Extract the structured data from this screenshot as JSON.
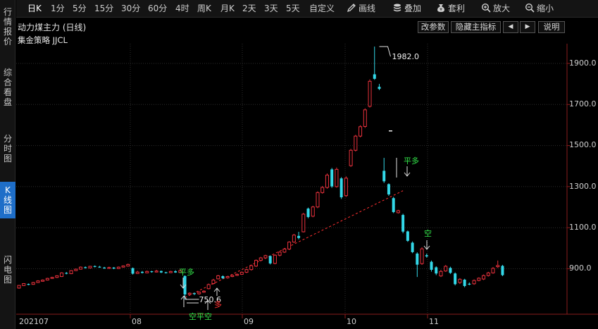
{
  "left_tabs": [
    {
      "label": "行情报价",
      "active": false
    },
    {
      "label": "综合看盘",
      "active": false
    },
    {
      "label": "分时图",
      "active": false
    },
    {
      "label": "K线图",
      "active": true
    },
    {
      "label": "闪电图",
      "active": false
    }
  ],
  "toolbar": {
    "periods": [
      "日K",
      "1分",
      "5分",
      "15分",
      "30分",
      "60分",
      "4时",
      "周K",
      "月K",
      "2天",
      "3天",
      "5天",
      "自定义"
    ],
    "active_period": "日K",
    "tools": [
      {
        "label": "画线",
        "icon": "pencil-icon"
      },
      {
        "label": "叠加",
        "icon": "stack-icon"
      },
      {
        "label": "套利",
        "icon": "arbitrage-icon"
      },
      {
        "label": "放大",
        "icon": "zoom-in-icon"
      },
      {
        "label": "缩小",
        "icon": "zoom-out-icon"
      }
    ]
  },
  "info_bar": {
    "indicator_name": "动力煤主力 (日线)",
    "buttons": {
      "modify_params": "改参数",
      "hide_indicator": "隐藏主指标",
      "prev": "◀",
      "next": "▶",
      "help": "说明"
    }
  },
  "strategy_label": "集金策略 JJCL",
  "chart_data": {
    "type": "candlestick",
    "yaxis": {
      "ticks": [
        "1900.0",
        "1700.0",
        "1500.0",
        "1300.0",
        "1100.0",
        "900.0"
      ]
    },
    "xaxis": {
      "ticks": [
        "202107",
        "08",
        "09",
        "10",
        "11"
      ]
    },
    "high_label": "1982.0",
    "low_label": "750.6",
    "colors": {
      "up": "#e8313c",
      "down": "#33d8e8",
      "signal_green": "#33e54a",
      "signal_red": "#ff3030",
      "trendline": "#ff3030"
    },
    "signals": [
      {
        "text": "平多",
        "color": "green"
      },
      {
        "text": "平多",
        "color": "green"
      },
      {
        "text": "空",
        "color": "green"
      },
      {
        "text": "空平空",
        "color": "green"
      },
      {
        "text": "多",
        "color": "red"
      }
    ],
    "candles": [
      {
        "o": 806,
        "c": 819,
        "h": 821,
        "l": 803
      },
      {
        "o": 818,
        "c": 828,
        "h": 830,
        "l": 816
      },
      {
        "o": 826,
        "c": 823,
        "h": 828,
        "l": 820
      },
      {
        "o": 824,
        "c": 833,
        "h": 836,
        "l": 822
      },
      {
        "o": 833,
        "c": 841,
        "h": 844,
        "l": 831
      },
      {
        "o": 839,
        "c": 845,
        "h": 848,
        "l": 837
      },
      {
        "o": 845,
        "c": 853,
        "h": 856,
        "l": 843
      },
      {
        "o": 853,
        "c": 858,
        "h": 861,
        "l": 851
      },
      {
        "o": 858,
        "c": 866,
        "h": 868,
        "l": 855
      },
      {
        "o": 862,
        "c": 880,
        "h": 883,
        "l": 860
      },
      {
        "o": 880,
        "c": 876,
        "h": 884,
        "l": 873
      },
      {
        "o": 876,
        "c": 891,
        "h": 893,
        "l": 874
      },
      {
        "o": 891,
        "c": 898,
        "h": 901,
        "l": 889
      },
      {
        "o": 898,
        "c": 908,
        "h": 911,
        "l": 896
      },
      {
        "o": 908,
        "c": 904,
        "h": 911,
        "l": 901
      },
      {
        "o": 904,
        "c": 912,
        "h": 914,
        "l": 902
      },
      {
        "o": 913,
        "c": 910,
        "h": 916,
        "l": 907
      },
      {
        "o": 910,
        "c": 907,
        "h": 914,
        "l": 905
      },
      {
        "o": 906,
        "c": 903,
        "h": 909,
        "l": 900
      },
      {
        "o": 902,
        "c": 906,
        "h": 910,
        "l": 900
      },
      {
        "o": 906,
        "c": 901,
        "h": 908,
        "l": 898
      },
      {
        "o": 901,
        "c": 908,
        "h": 911,
        "l": 899
      },
      {
        "o": 908,
        "c": 914,
        "h": 916,
        "l": 906
      },
      {
        "o": 913,
        "c": 921,
        "h": 925,
        "l": 911
      },
      {
        "o": 903,
        "c": 876,
        "h": 906,
        "l": 872
      },
      {
        "o": 877,
        "c": 884,
        "h": 890,
        "l": 875
      },
      {
        "o": 885,
        "c": 880,
        "h": 889,
        "l": 877
      },
      {
        "o": 880,
        "c": 887,
        "h": 891,
        "l": 878
      },
      {
        "o": 888,
        "c": 884,
        "h": 890,
        "l": 881
      },
      {
        "o": 884,
        "c": 889,
        "h": 895,
        "l": 882
      },
      {
        "o": 889,
        "c": 882,
        "h": 891,
        "l": 879
      },
      {
        "o": 883,
        "c": 880,
        "h": 885,
        "l": 877
      },
      {
        "o": 881,
        "c": 887,
        "h": 890,
        "l": 879
      },
      {
        "o": 888,
        "c": 882,
        "h": 893,
        "l": 880
      },
      {
        "o": 882,
        "c": 891,
        "h": 896,
        "l": 880
      },
      {
        "o": 865,
        "c": 775,
        "h": 868,
        "l": 751
      },
      {
        "o": 775,
        "c": 781,
        "h": 785,
        "l": 770
      },
      {
        "o": 781,
        "c": 777,
        "h": 784,
        "l": 772
      },
      {
        "o": 778,
        "c": 786,
        "h": 790,
        "l": 774
      },
      {
        "o": 786,
        "c": 791,
        "h": 795,
        "l": 783
      },
      {
        "o": 803,
        "c": 823,
        "h": 828,
        "l": 800
      },
      {
        "o": 828,
        "c": 845,
        "h": 851,
        "l": 824
      },
      {
        "o": 851,
        "c": 866,
        "h": 870,
        "l": 848
      },
      {
        "o": 864,
        "c": 854,
        "h": 868,
        "l": 850
      },
      {
        "o": 856,
        "c": 862,
        "h": 866,
        "l": 852
      },
      {
        "o": 862,
        "c": 868,
        "h": 872,
        "l": 859
      },
      {
        "o": 868,
        "c": 873,
        "h": 877,
        "l": 865
      },
      {
        "o": 873,
        "c": 883,
        "h": 887,
        "l": 870
      },
      {
        "o": 883,
        "c": 896,
        "h": 900,
        "l": 879
      },
      {
        "o": 896,
        "c": 915,
        "h": 920,
        "l": 891
      },
      {
        "o": 913,
        "c": 941,
        "h": 945,
        "l": 909
      },
      {
        "o": 941,
        "c": 953,
        "h": 958,
        "l": 935
      },
      {
        "o": 953,
        "c": 964,
        "h": 968,
        "l": 948
      },
      {
        "o": 962,
        "c": 926,
        "h": 965,
        "l": 921
      },
      {
        "o": 926,
        "c": 966,
        "h": 970,
        "l": 922
      },
      {
        "o": 966,
        "c": 981,
        "h": 985,
        "l": 960
      },
      {
        "o": 981,
        "c": 996,
        "h": 1001,
        "l": 977
      },
      {
        "o": 996,
        "c": 1030,
        "h": 1034,
        "l": 991
      },
      {
        "o": 1030,
        "c": 1064,
        "h": 1070,
        "l": 1026
      },
      {
        "o": 1060,
        "c": 1050,
        "h": 1080,
        "l": 1043
      },
      {
        "o": 1080,
        "c": 1166,
        "h": 1172,
        "l": 1077
      },
      {
        "o": 1193,
        "c": 1152,
        "h": 1198,
        "l": 1146
      },
      {
        "o": 1156,
        "c": 1201,
        "h": 1207,
        "l": 1151
      },
      {
        "o": 1201,
        "c": 1271,
        "h": 1277,
        "l": 1195
      },
      {
        "o": 1271,
        "c": 1296,
        "h": 1303,
        "l": 1266
      },
      {
        "o": 1296,
        "c": 1356,
        "h": 1364,
        "l": 1290
      },
      {
        "o": 1384,
        "c": 1301,
        "h": 1391,
        "l": 1294
      },
      {
        "o": 1300,
        "c": 1384,
        "h": 1393,
        "l": 1295
      },
      {
        "o": 1340,
        "c": 1248,
        "h": 1346,
        "l": 1240
      },
      {
        "o": 1256,
        "c": 1341,
        "h": 1350,
        "l": 1250
      },
      {
        "o": 1402,
        "c": 1477,
        "h": 1484,
        "l": 1396
      },
      {
        "o": 1477,
        "c": 1546,
        "h": 1552,
        "l": 1471
      },
      {
        "o": 1546,
        "c": 1592,
        "h": 1599,
        "l": 1540
      },
      {
        "o": 1593,
        "c": 1674,
        "h": 1681,
        "l": 1586
      },
      {
        "o": 1691,
        "c": 1813,
        "h": 1822,
        "l": 1685
      },
      {
        "o": 1847,
        "c": 1825,
        "h": 1982,
        "l": 1820
      },
      {
        "o": 1786,
        "c": 1776,
        "h": 1800,
        "l": 1770
      },
      {
        "o": 1377,
        "c": 1326,
        "h": 1440,
        "l": 1318
      },
      {
        "o": 1312,
        "c": 1262,
        "h": 1316,
        "l": 1255
      },
      {
        "o": 1244,
        "c": 1176,
        "h": 1250,
        "l": 1171
      },
      {
        "o": 1173,
        "c": 1183,
        "h": 1187,
        "l": 1169
      },
      {
        "o": 1162,
        "c": 1081,
        "h": 1168,
        "l": 1073
      },
      {
        "o": 1082,
        "c": 1036,
        "h": 1086,
        "l": 1031
      },
      {
        "o": 1027,
        "c": 981,
        "h": 1033,
        "l": 976
      },
      {
        "o": 974,
        "c": 920,
        "h": 980,
        "l": 860
      },
      {
        "o": 925,
        "c": 997,
        "h": 1005,
        "l": 919
      },
      {
        "o": 966,
        "c": 960,
        "h": 974,
        "l": 954
      },
      {
        "o": 934,
        "c": 895,
        "h": 940,
        "l": 886
      },
      {
        "o": 907,
        "c": 877,
        "h": 912,
        "l": 869
      },
      {
        "o": 865,
        "c": 887,
        "h": 895,
        "l": 860
      },
      {
        "o": 889,
        "c": 912,
        "h": 918,
        "l": 885
      },
      {
        "o": 904,
        "c": 880,
        "h": 910,
        "l": 875
      },
      {
        "o": 877,
        "c": 825,
        "h": 882,
        "l": 819
      },
      {
        "o": 833,
        "c": 849,
        "h": 854,
        "l": 826
      },
      {
        "o": 847,
        "c": 816,
        "h": 851,
        "l": 810
      },
      {
        "o": 827,
        "c": 825,
        "h": 833,
        "l": 820
      },
      {
        "o": 827,
        "c": 843,
        "h": 848,
        "l": 822
      },
      {
        "o": 843,
        "c": 854,
        "h": 858,
        "l": 839
      },
      {
        "o": 850,
        "c": 867,
        "h": 872,
        "l": 845
      },
      {
        "o": 867,
        "c": 880,
        "h": 885,
        "l": 862
      },
      {
        "o": 880,
        "c": 902,
        "h": 908,
        "l": 876
      },
      {
        "o": 910,
        "c": 916,
        "h": 940,
        "l": 904
      },
      {
        "o": 914,
        "c": 869,
        "h": 919,
        "l": 864
      }
    ]
  }
}
